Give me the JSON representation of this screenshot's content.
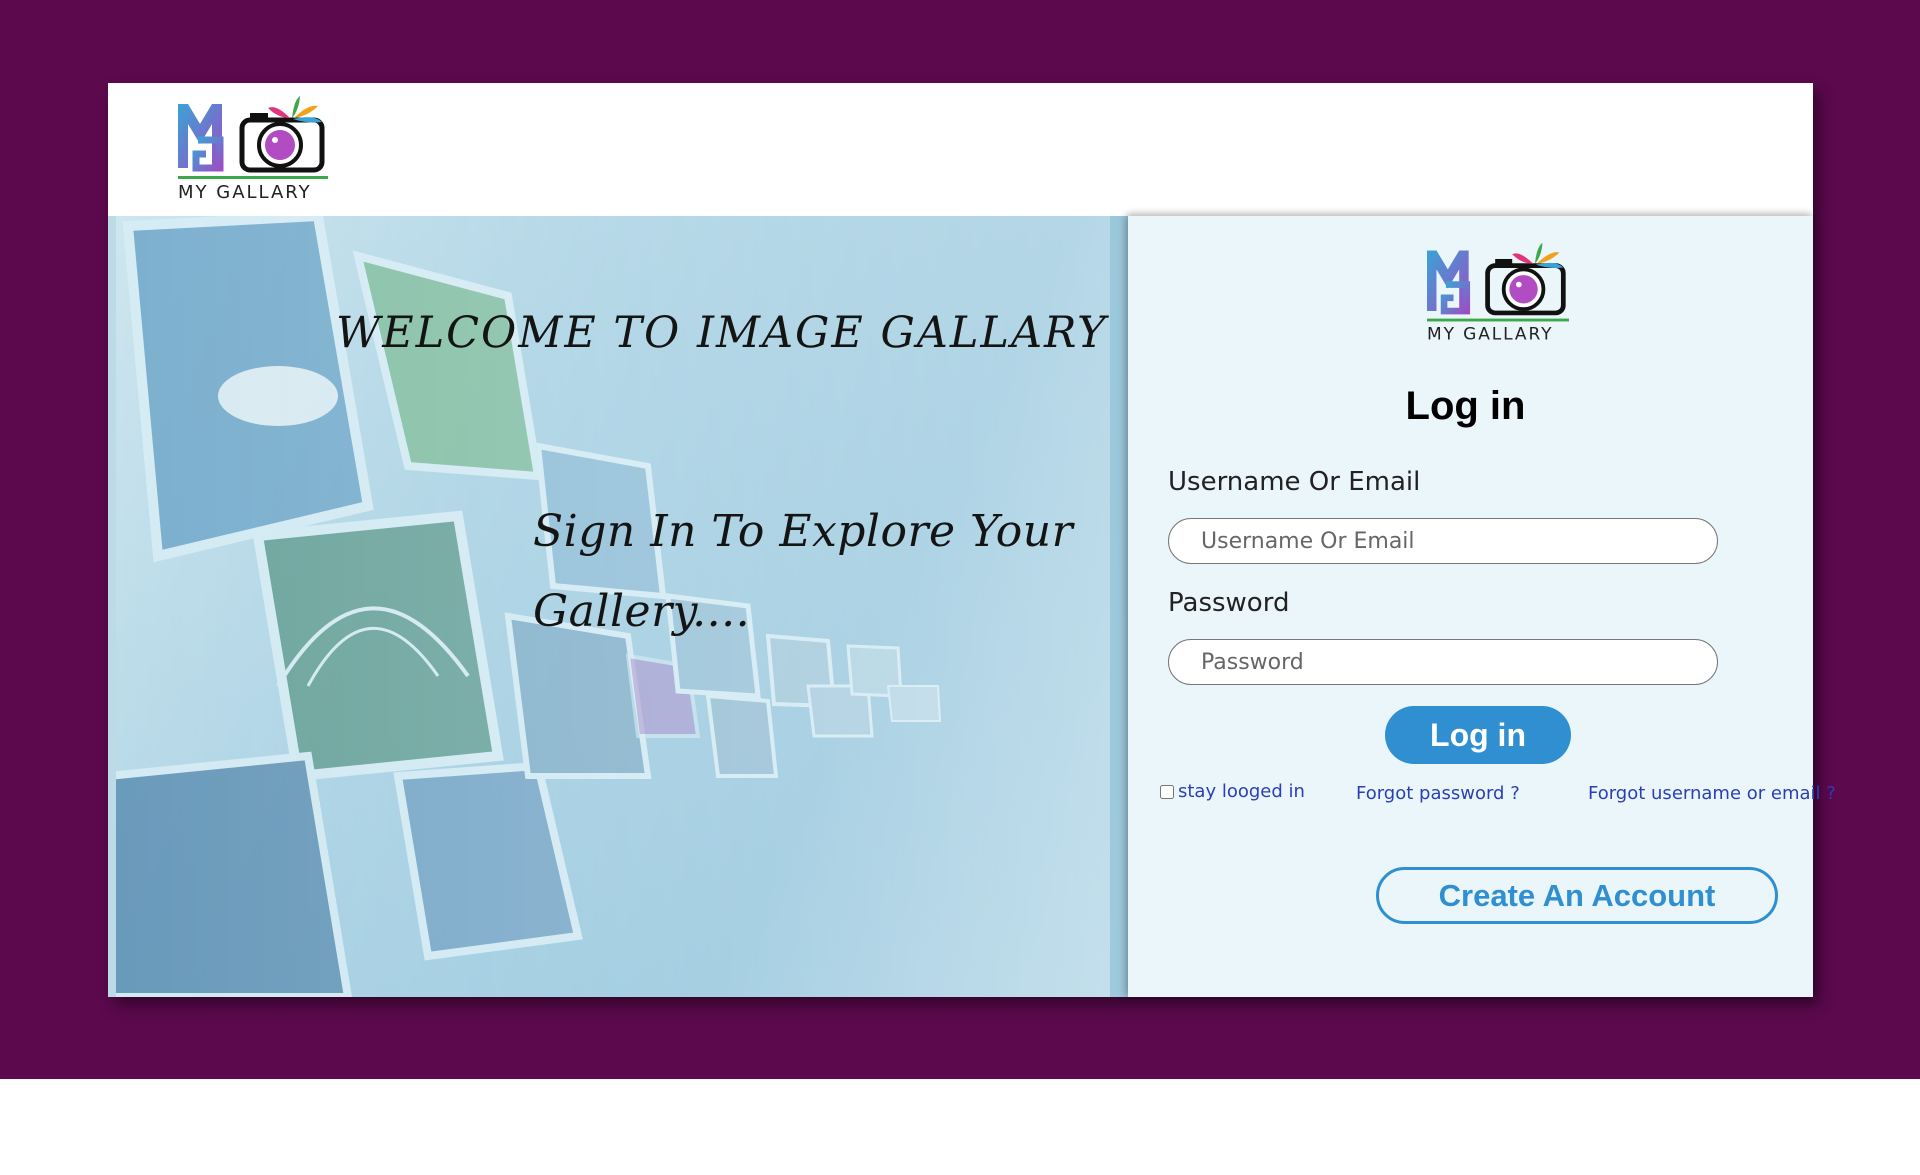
{
  "header": {
    "logo_text": "MY GALLARY"
  },
  "hero": {
    "title": "WELCOME TO IMAGE GALLARY",
    "subtitle": "Sign In To Explore Your Gallery...."
  },
  "login": {
    "logo_text": "MY GALLARY",
    "title": "Log in",
    "username_label": "Username Or Email",
    "username_placeholder": "Username Or Email",
    "password_label": "Password",
    "password_placeholder": "Password",
    "login_button": "Log in",
    "stay_logged_in": "stay looged in",
    "forgot_password": "Forgot password ?",
    "forgot_username": "Forgot username or email ?",
    "create_account": "Create An Account"
  },
  "colors": {
    "page_background": "#5c094e",
    "accent": "#2f8fd0",
    "link": "#2a3fb5",
    "panel_background": "#ebf6fa"
  },
  "icons": {
    "logo": "camera-logo-icon",
    "hero_background": "photo-gallery-tunnel"
  }
}
